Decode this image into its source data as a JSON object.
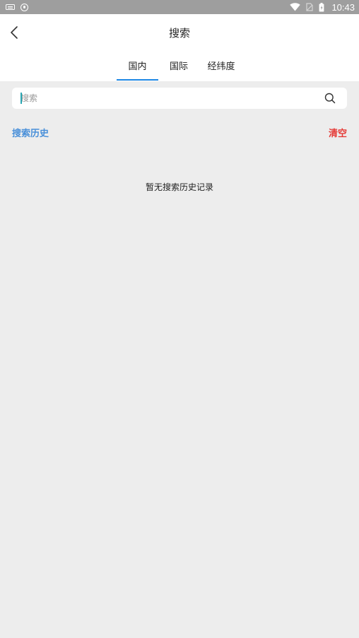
{
  "status_bar": {
    "time": "10:43",
    "icons": [
      "keyboard-icon",
      "shield-icon",
      "wifi-icon",
      "sim-icon",
      "battery-icon"
    ]
  },
  "header": {
    "title": "搜索",
    "back_icon": "chevron-left-icon"
  },
  "tabs": [
    {
      "label": "国内",
      "active": true
    },
    {
      "label": "国际",
      "active": false
    },
    {
      "label": "经纬度",
      "active": false
    }
  ],
  "search": {
    "placeholder": "搜索",
    "value": "",
    "icon": "search-icon"
  },
  "history": {
    "title": "搜索历史",
    "clear_label": "清空",
    "empty_text": "暂无搜索历史记录"
  },
  "colors": {
    "accent": "#1e88e5",
    "history_title": "#4a90d9",
    "clear": "#e53935",
    "background": "#ededed"
  }
}
